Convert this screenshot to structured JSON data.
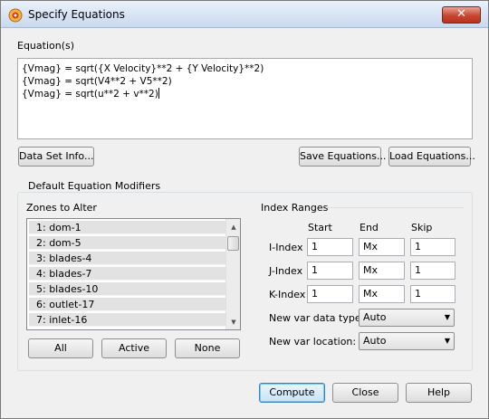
{
  "window": {
    "title": "Specify Equations",
    "close_label": "✕"
  },
  "equations": {
    "label": "Equation(s)",
    "lines": [
      "{Vmag} = sqrt({X Velocity}**2 + {Y Velocity}**2)",
      "{Vmag} = sqrt(V4**2 + V5**2)",
      "{Vmag} = sqrt(u**2 + v**2)"
    ]
  },
  "buttons": {
    "data_set_info": "Data Set Info...",
    "save_equations": "Save Equations...",
    "load_equations": "Load Equations...",
    "all": "All",
    "active": "Active",
    "none": "None",
    "compute": "Compute",
    "close": "Close",
    "help": "Help"
  },
  "modifiers": {
    "group_title": "Default Equation Modifiers",
    "zones_label": "Zones to Alter",
    "zones": [
      "1: dom-1",
      "2: dom-5",
      "3: blades-4",
      "4: blades-7",
      "5: blades-10",
      "6: outlet-17",
      "7: inlet-16"
    ]
  },
  "index_ranges": {
    "title": "Index Ranges",
    "col_start": "Start",
    "col_end": "End",
    "col_skip": "Skip",
    "rows": [
      {
        "label": "I-Index",
        "start": "1",
        "end": "Mx",
        "skip": "1"
      },
      {
        "label": "J-Index",
        "start": "1",
        "end": "Mx",
        "skip": "1"
      },
      {
        "label": "K-Index",
        "start": "1",
        "end": "Mx",
        "skip": "1"
      }
    ],
    "data_type_label": "New var data type:",
    "data_type_value": "Auto",
    "location_label": "New var location:",
    "location_value": "Auto"
  },
  "icons": {
    "app": "tecplot-icon",
    "scroll_up": "scroll-up-icon",
    "scroll_down": "scroll-down-icon",
    "dropdown": "chevron-down-icon"
  }
}
